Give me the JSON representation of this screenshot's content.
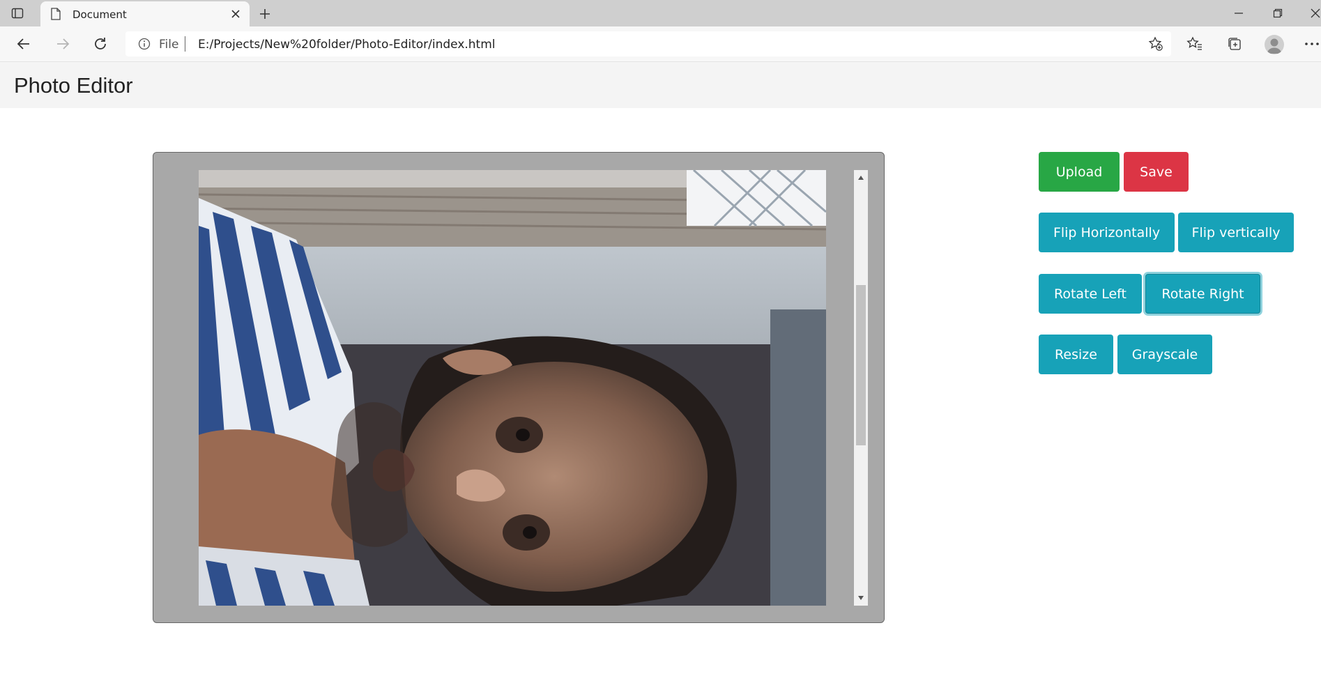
{
  "browser": {
    "tab_title": "Document",
    "address_protocol": "File",
    "url": "E:/Projects/New%20folder/Photo-Editor/index.html",
    "icons": [
      "tab-actions-icon",
      "document-icon",
      "close-icon",
      "plus-icon",
      "minimize-icon",
      "restore-icon",
      "window-close-icon",
      "back-arrow-icon",
      "forward-arrow-icon",
      "refresh-icon",
      "info-icon",
      "add-favorite-icon",
      "favorites-icon",
      "collections-icon",
      "profile-avatar-icon",
      "more-icon"
    ]
  },
  "page": {
    "brand": "Photo Editor"
  },
  "editor": {
    "image_content": "rotated webcam photo of a person"
  },
  "controls": {
    "upload_label": "Upload",
    "save_label": "Save",
    "flip_h_label": "Flip Horizontally",
    "flip_v_label": "Flip vertically",
    "rotate_left_label": "Rotate Left",
    "rotate_right_label": "Rotate Right",
    "resize_label": "Resize",
    "grayscale_label": "Grayscale"
  },
  "colors": {
    "success": "#28a745",
    "danger": "#dc3545",
    "info": "#17a2b8",
    "editor_bg": "#a8a8a8",
    "navbar_bg": "#f4f4f4"
  }
}
